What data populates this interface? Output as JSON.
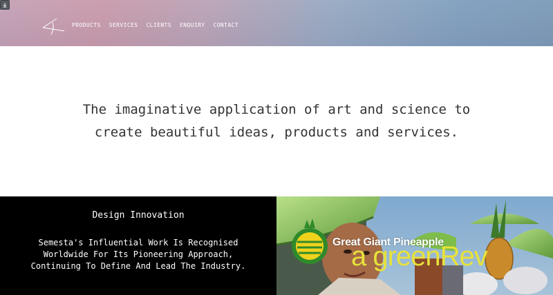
{
  "header": {
    "nav": [
      {
        "label": "PRODUCTS"
      },
      {
        "label": "SERVICES"
      },
      {
        "label": "CLIENTS"
      },
      {
        "label": "ENQUIRY"
      },
      {
        "label": "CONTACT"
      }
    ]
  },
  "hero": {
    "tagline_line1": "The imaginative application of art and science to",
    "tagline_line2": "create beautiful ideas, products and services."
  },
  "feature": {
    "heading": "Design Innovation",
    "body_line1": "Semesta's Influential Work Is Recognised",
    "body_line2": "Worldwide For Its Pioneering Approach,",
    "body_line3": "Continuing To Define And Lead The Industry."
  },
  "promo": {
    "brand": "Great Giant Pineapple",
    "slogan": "a greenRev"
  },
  "colors": {
    "panel_bg": "#000000",
    "slogan_yellow": "#e8e23a",
    "logo_green": "#2f8a2a"
  }
}
